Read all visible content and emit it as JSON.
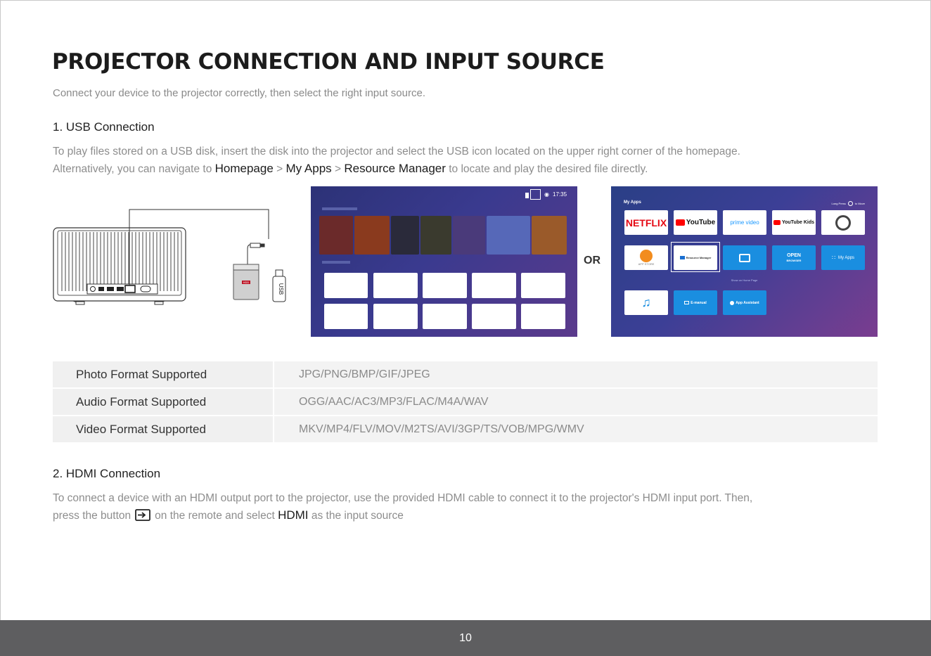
{
  "title": "PROJECTOR CONNECTION AND INPUT SOURCE",
  "subtitle": "Connect your device to the projector correctly, then select the right input source.",
  "usb": {
    "heading": "1. USB Connection",
    "line1": "To play files stored on a USB disk, insert the disk into the projector and select the USB icon located on the upper right corner of the homepage.",
    "line2_pre": "Alternatively, you can navigate to ",
    "link_homepage": "Homepage",
    "sep1": " > ",
    "link_myapps": "My Apps",
    "sep2": " > ",
    "link_resource": "Resource Manager",
    "line2_post": " to locate and play the desired file directly.",
    "usb_stick_label": "USB",
    "drive_label": "HDD"
  },
  "screen1": {
    "time": "17:35"
  },
  "or_label": "OR",
  "screen2": {
    "my_apps_title": "My Apps",
    "long_press": "Long Press",
    "to_move": "to Move",
    "apps_row1": [
      "NETFLIX",
      "YouTube",
      "prime video",
      "YouTube Kids",
      ""
    ],
    "app_store": "APP STORE",
    "resource_manager": "Resource Manager",
    "open_browser": "OPEN",
    "browser": "BROWSER",
    "my_apps_tile": "My Apps",
    "show_on_home": "Show on Home Page",
    "emanual": "E-manual",
    "app_assistant": "App Assistant"
  },
  "formats": [
    {
      "label": "Photo Format Supported",
      "value": "JPG/PNG/BMP/GIF/JPEG"
    },
    {
      "label": "Audio Format Supported",
      "value": "OGG/AAC/AC3/MP3/FLAC/M4A/WAV"
    },
    {
      "label": "Video Format Supported",
      "value": "MKV/MP4/FLV/MOV/M2TS/AVI/3GP/TS/VOB/MPG/WMV"
    }
  ],
  "hdmi": {
    "heading": "2. HDMI Connection",
    "line1": "To connect a device with an HDMI output port to the projector, use the provided HDMI cable to connect it to the projector's HDMI input port. Then,",
    "line2_pre": "press the button",
    "line2_mid": "on the remote and select",
    "hdmi_word": "HDMI",
    "line2_post": "as the input source",
    "button_icon": "input-source-icon"
  },
  "page_number": "10",
  "colors": {
    "footer": "#5e5e60",
    "netflix": "#e50914",
    "youtube": "#ff0000",
    "app_blue": "#1a8ee0"
  }
}
